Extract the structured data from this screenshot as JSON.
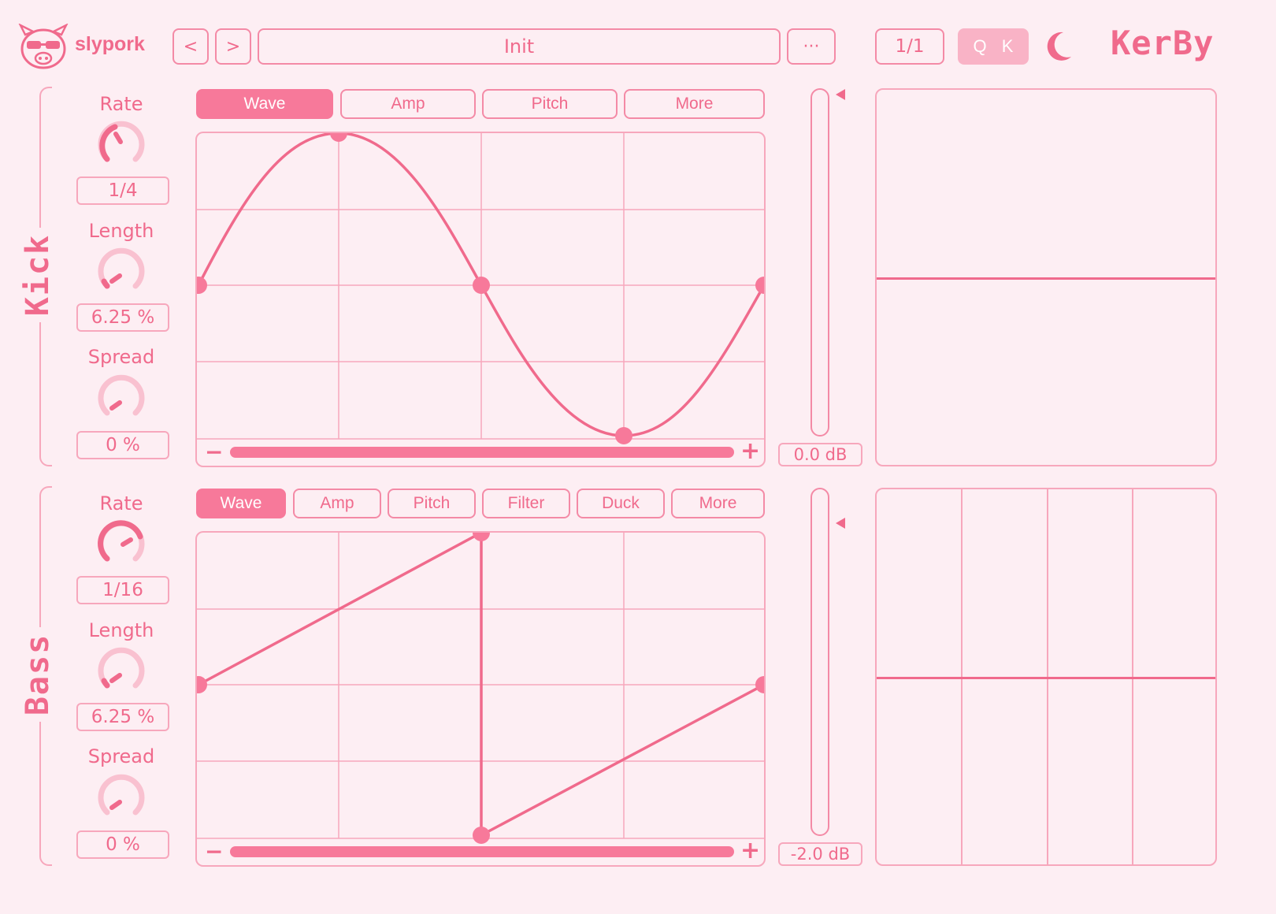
{
  "brand": {
    "name": "slypork",
    "product": "KerBy"
  },
  "topbar": {
    "prev_label": "<",
    "next_label": ">",
    "preset_name": "Init",
    "more_label": "···",
    "ratio_label": "1/1",
    "q_label": "Q",
    "k_label": "K"
  },
  "kick": {
    "name": "Kick",
    "tabs": [
      "Wave",
      "Amp",
      "Pitch",
      "More"
    ],
    "active_tab": "Wave",
    "params": [
      {
        "label": "Rate",
        "value": "1/4"
      },
      {
        "label": "Length",
        "value": "6.25 %"
      },
      {
        "label": "Spread",
        "value": "0 %"
      }
    ],
    "gain": "0.0 dB",
    "zoom_minus": "−",
    "zoom_plus": "+"
  },
  "bass": {
    "name": "Bass",
    "tabs": [
      "Wave",
      "Amp",
      "Pitch",
      "Filter",
      "Duck",
      "More"
    ],
    "active_tab": "Wave",
    "params": [
      {
        "label": "Rate",
        "value": "1/16"
      },
      {
        "label": "Length",
        "value": "6.25 %"
      },
      {
        "label": "Spread",
        "value": "0 %"
      }
    ],
    "gain": "-2.0 dB",
    "zoom_minus": "−",
    "zoom_plus": "+"
  },
  "colors": {
    "accent": "#f7799a",
    "line": "#f06a8c",
    "light": "#f7a7bc",
    "bg": "#fdeef3"
  },
  "icons": {
    "logo": "pig-icon",
    "theme": "moon-icon"
  }
}
